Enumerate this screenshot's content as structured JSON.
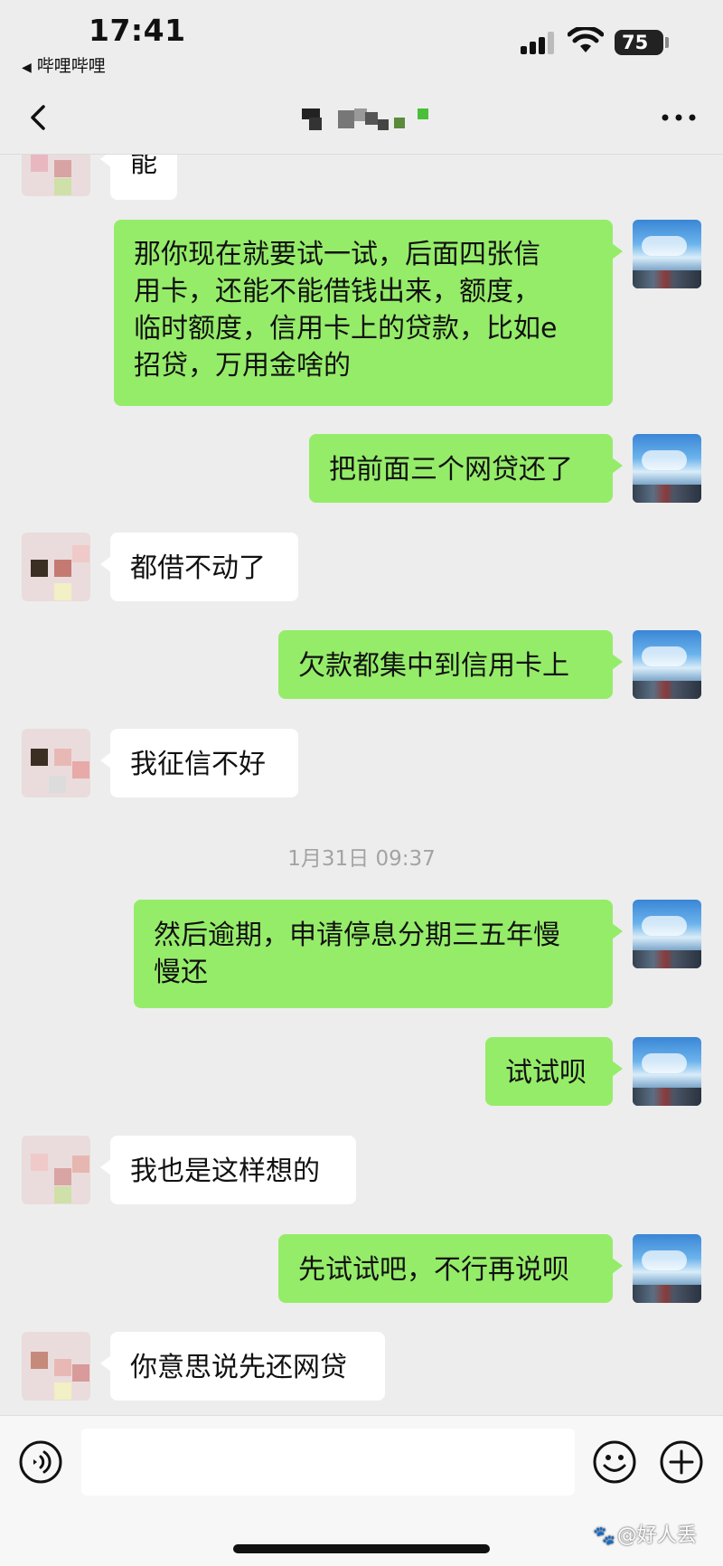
{
  "status_bar": {
    "time": "17:41",
    "back_app": "哔哩哔哩",
    "battery": "75",
    "icons": [
      "signal-icon",
      "wifi-icon",
      "battery-icon"
    ]
  },
  "nav": {
    "back_icon": "chevron-left-icon",
    "title": "(pixelated contact name)",
    "more_icon": "more-dots-icon"
  },
  "messages": [
    {
      "side": "them",
      "text": "能"
    },
    {
      "side": "me",
      "lines": [
        "那你现在就要试一试，后面四张信",
        "用卡，还能不能借钱出来，额度，",
        "临时额度，信用卡上的贷款，比如e",
        "招贷，万用金啥的"
      ]
    },
    {
      "side": "me",
      "text": "把前面三个网贷还了"
    },
    {
      "side": "them",
      "text": "都借不动了"
    },
    {
      "side": "me",
      "text": "欠款都集中到信用卡上"
    },
    {
      "side": "them",
      "text": "我征信不好"
    },
    {
      "side": "me",
      "lines": [
        "然后逾期，申请停息分期三五年慢",
        "慢还"
      ]
    },
    {
      "side": "me",
      "text": "试试呗"
    },
    {
      "side": "them",
      "text": "我也是这样想的"
    },
    {
      "side": "me",
      "text": "先试试吧，不行再说呗"
    },
    {
      "side": "them",
      "text": "你意思说先还网贷"
    }
  ],
  "timestamp": "1月31日 09:37",
  "input_bar": {
    "placeholder": "",
    "icons": [
      "voice-icon",
      "emoji-icon",
      "plus-icon"
    ]
  },
  "watermark": "@好人丢",
  "colors": {
    "background": "#ededed",
    "my_bubble": "#95ec69",
    "their_bubble": "#ffffff",
    "timestamp": "#a3a3a3"
  }
}
